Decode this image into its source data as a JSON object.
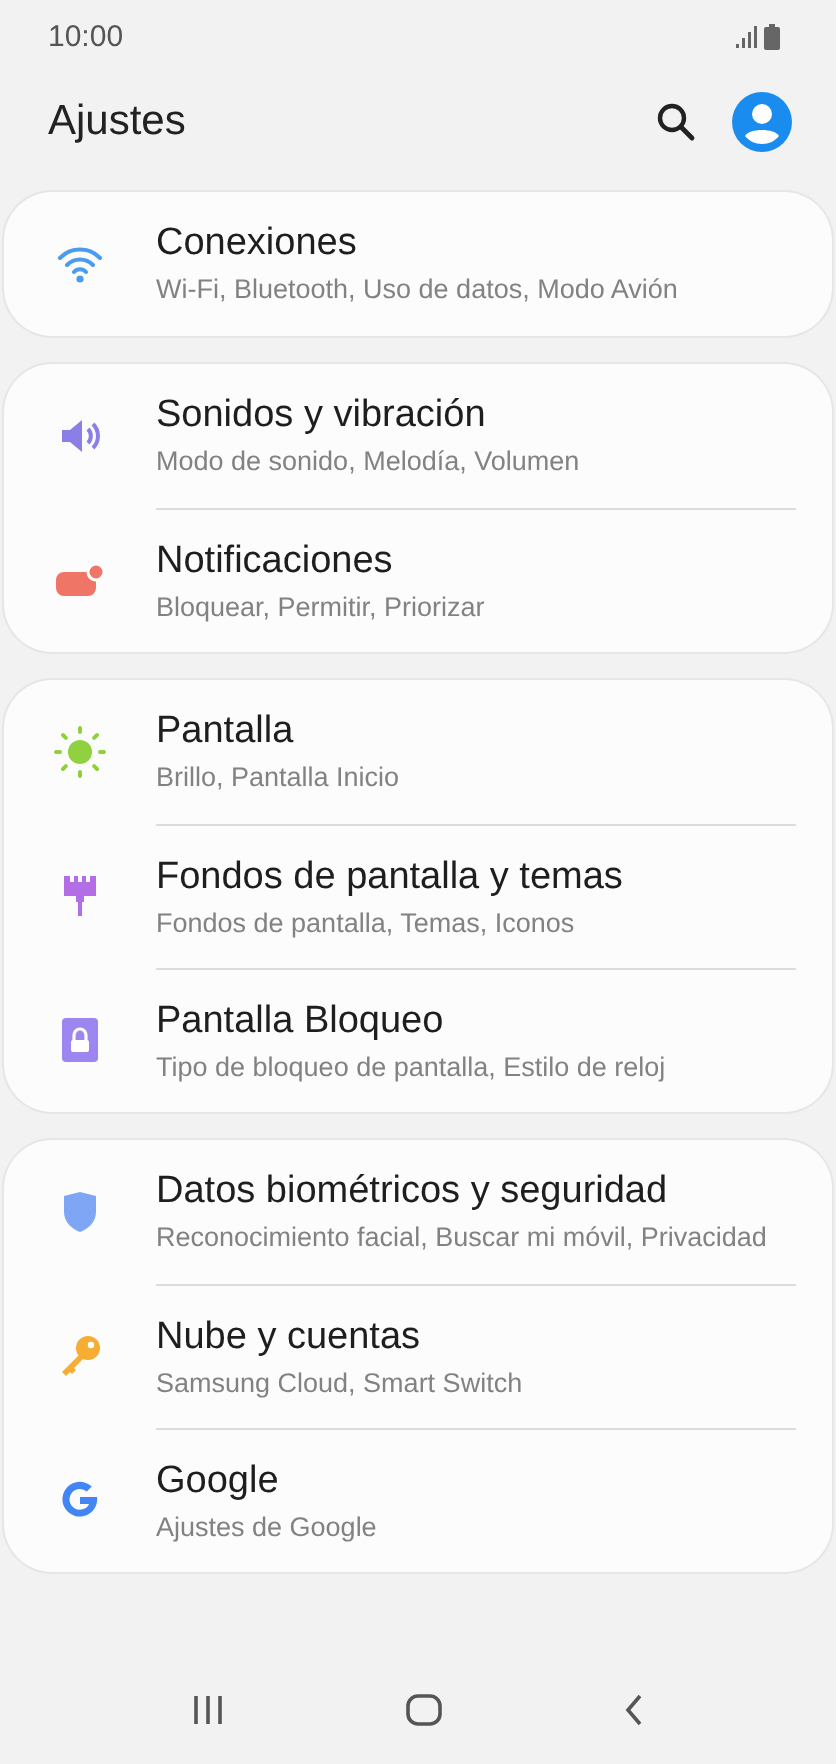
{
  "status_bar": {
    "time": "10:00"
  },
  "header": {
    "title": "Ajustes"
  },
  "groups": [
    {
      "items": [
        {
          "title": "Conexiones",
          "subtitle": "Wi-Fi, Bluetooth, Uso de datos, Modo Avión",
          "color": "#4a9cf0"
        }
      ]
    },
    {
      "items": [
        {
          "title": "Sonidos y vibración",
          "subtitle": "Modo de sonido, Melodía, Volumen",
          "color": "#8a7fe6"
        },
        {
          "title": "Notificaciones",
          "subtitle": "Bloquear, Permitir, Priorizar",
          "color": "#ef7567"
        }
      ]
    },
    {
      "items": [
        {
          "title": "Pantalla",
          "subtitle": "Brillo, Pantalla Inicio",
          "color": "#8fd13f"
        },
        {
          "title": "Fondos de pantalla y temas",
          "subtitle": "Fondos de pantalla, Temas, Iconos",
          "color": "#b36ee6"
        },
        {
          "title": "Pantalla Bloqueo",
          "subtitle": "Tipo de bloqueo de pantalla, Estilo de reloj",
          "color": "#9d86f0"
        }
      ]
    },
    {
      "items": [
        {
          "title": "Datos biométricos y seguridad",
          "subtitle": "Reconocimiento facial, Buscar mi móvil, Privacidad",
          "color": "#7fa6f5"
        },
        {
          "title": "Nube y cuentas",
          "subtitle": "Samsung Cloud, Smart Switch",
          "color": "#f5ad33"
        },
        {
          "title": "Google",
          "subtitle": "Ajustes de Google",
          "color": "#4285f4"
        }
      ]
    }
  ]
}
